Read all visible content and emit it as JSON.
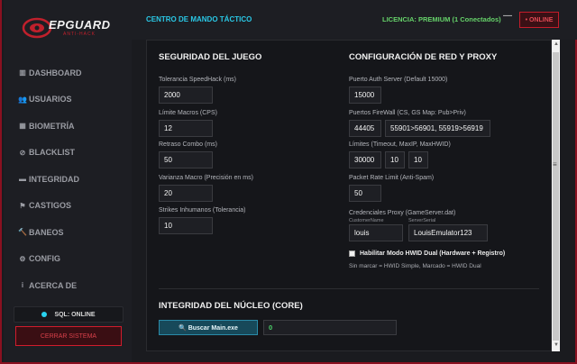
{
  "brand": {
    "name": "EPGUARD",
    "sub": "ANTI-HACK"
  },
  "header": {
    "title": "CENTRO DE MANDO TÁCTICO",
    "license": "LICENCIA: PREMIUM (1 Conectados)",
    "minimize": "—",
    "status": "• ONLINE"
  },
  "sidebar": {
    "items": [
      {
        "label": "DASHBOARD",
        "icon": "dashboard-icon",
        "glyph": "▥"
      },
      {
        "label": "USUARIOS",
        "icon": "users-icon",
        "glyph": "👥"
      },
      {
        "label": "BIOMETRÍA",
        "icon": "biometrics-icon",
        "glyph": "▦"
      },
      {
        "label": "BLACKLIST",
        "icon": "ban-icon",
        "glyph": "⊘"
      },
      {
        "label": "INTEGRIDAD",
        "icon": "integrity-icon",
        "glyph": "▬"
      },
      {
        "label": "CASTIGOS",
        "icon": "punish-icon",
        "glyph": "⚑"
      },
      {
        "label": "BANEOS",
        "icon": "hammer-icon",
        "glyph": "🔨"
      },
      {
        "label": "CONFIG",
        "icon": "gear-icon",
        "glyph": "⚙"
      },
      {
        "label": "ACERCA DE",
        "icon": "info-icon",
        "glyph": "i"
      }
    ],
    "sql_status": "SQL: ONLINE",
    "logout": "CERRAR SISTEMA"
  },
  "game_security": {
    "title": "SEGURIDAD DEL JUEGO",
    "fields": [
      {
        "label": "Tolerancia SpeedHack (ms)",
        "value": "2000"
      },
      {
        "label": "Límite Macros (CPS)",
        "value": "12"
      },
      {
        "label": "Retraso Combo (ms)",
        "value": "50"
      },
      {
        "label": "Varianza Macro (Precisión en ms)",
        "value": "20"
      },
      {
        "label": "Strikes Inhumanos (Tolerancia)",
        "value": "10"
      }
    ]
  },
  "network": {
    "title": "CONFIGURACIÓN DE RED Y PROXY",
    "auth_label": "Puerto Auth Server (Default 15000)",
    "auth_value": "15000",
    "firewall_label": "Puertos FireWall (CS, GS Map: Pub>Priv)",
    "firewall_cs": "44405",
    "firewall_gs": "55901>56901, 55919>56919",
    "limits_label": "Límites (Timeout, MaxIP, MaxHWID)",
    "limits": [
      "30000",
      "10",
      "10"
    ],
    "packet_label": "Packet Rate Limit (Anti-Spam)",
    "packet_value": "50",
    "creds_label": "Credenciales Proxy (GameServer.dat)",
    "user_label": "CustomerName",
    "user_value": "louis",
    "serial_label": "ServerSerial",
    "serial_value": "LouisEmulator123",
    "hwid_label": "Habilitar Modo HWID Dual (Hardware + Registro)",
    "hwid_hint": "Sin marcar = HWID Simple, Marcado = HWID Dual"
  },
  "core": {
    "title": "INTEGRIDAD DEL NÚCLEO (CORE)",
    "search_button": "🔍 Buscar Main.exe",
    "result": "0"
  },
  "colors": {
    "accent": "#2ac8e6",
    "danger": "#c41c2a",
    "success": "#66d26a"
  }
}
